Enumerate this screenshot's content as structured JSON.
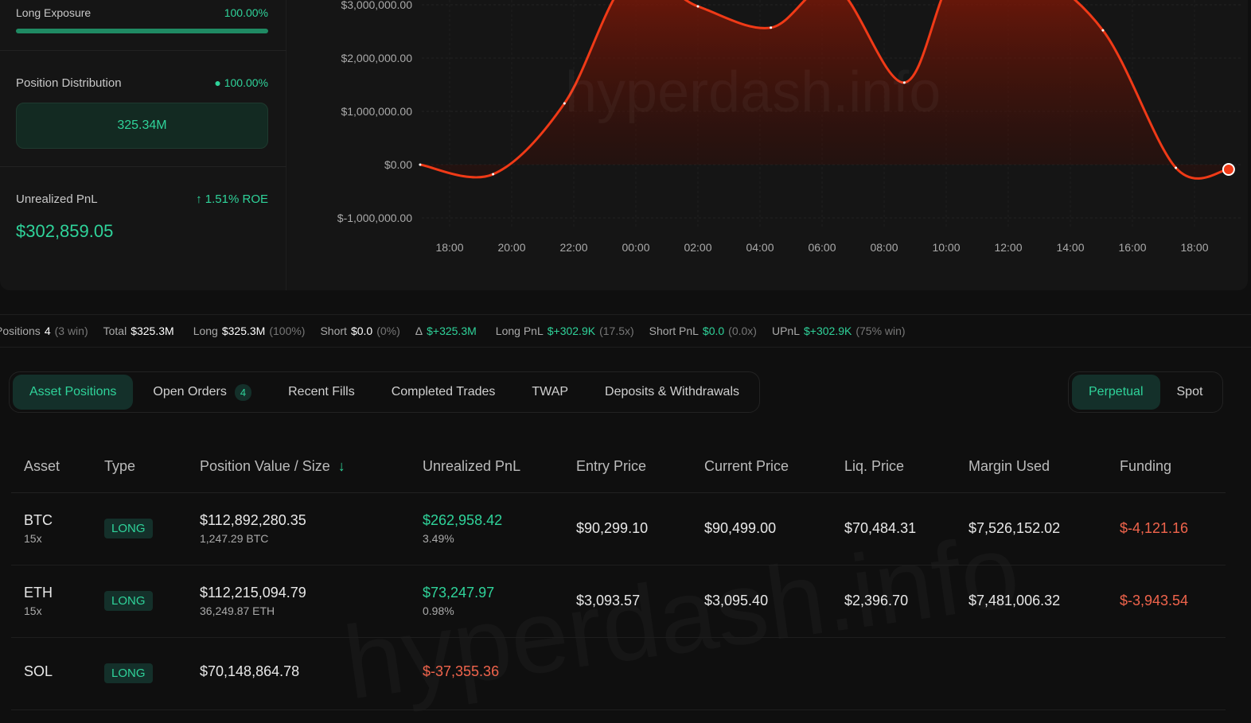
{
  "left": {
    "long_exposure_label": "Long Exposure",
    "long_exposure_value": "100.00%",
    "long_exposure_fraction": 1.0,
    "distribution_label": "Position Distribution",
    "distribution_value": "100.00%",
    "distribution_bar": "325.34M",
    "upnl_label": "Unrealized PnL",
    "upnl_roe": "↑ 1.51% ROE",
    "upnl_value": "$302,859.05"
  },
  "watermark": "hyperdash.info",
  "chart_data": {
    "type": "area",
    "color": "#f03a17",
    "yticks": [
      "$3,000,000.00",
      "$2,000,000.00",
      "$1,000,000.00",
      "$0.00",
      "$-1,000,000.00"
    ],
    "ytick_values": [
      3000000,
      2000000,
      1000000,
      0,
      -1000000
    ],
    "xticks": [
      "18:00",
      "20:00",
      "22:00",
      "00:00",
      "02:00",
      "04:00",
      "06:00",
      "08:00",
      "10:00",
      "12:00",
      "14:00",
      "16:00",
      "18:00"
    ],
    "x_hours_from_first_tick": [
      -0.95,
      1.4,
      3.7,
      5.8,
      8.0,
      10.35,
      12.4,
      14.65,
      16.3,
      18.5,
      21.05,
      23.4,
      25.1
    ],
    "values": [
      0,
      -180000,
      1150000,
      3500000,
      2970000,
      2570000,
      3350000,
      1540000,
      3600000,
      3700000,
      2520000,
      -60000,
      -90000
    ]
  },
  "stats": [
    {
      "label": "Positions",
      "value": "4",
      "extra": "(3 win)",
      "color": "w"
    },
    {
      "label": "Total",
      "value": "$325.3M",
      "extra": "",
      "color": "w"
    },
    {
      "label": "Long",
      "value": "$325.3M",
      "extra": "(100%)",
      "color": "w"
    },
    {
      "label": "Short",
      "value": "$0.0",
      "extra": "(0%)",
      "color": "w"
    },
    {
      "label": "Δ",
      "value": "$+325.3M",
      "extra": "",
      "color": "grn"
    },
    {
      "label": "Long PnL",
      "value": "$+302.9K",
      "extra": "(17.5x)",
      "color": "grn"
    },
    {
      "label": "Short PnL",
      "value": "$0.0",
      "extra": "(0.0x)",
      "color": "grn"
    },
    {
      "label": "UPnL",
      "value": "$+302.9K",
      "extra": "(75% win)",
      "color": "grn"
    }
  ],
  "tabs": [
    "Asset Positions",
    "Open Orders",
    "Recent Fills",
    "Completed Trades",
    "TWAP",
    "Deposits & Withdrawals"
  ],
  "open_orders_count": "4",
  "market_tabs": [
    "Perpetual",
    "Spot"
  ],
  "columns": [
    "Asset",
    "Type",
    "Position Value / Size",
    "Unrealized PnL",
    "Entry Price",
    "Current Price",
    "Liq. Price",
    "Margin Used",
    "Funding"
  ],
  "sort_icon": "arrow-down-icon",
  "rows": [
    {
      "asset": "BTC",
      "lev": "15x",
      "type": "LONG",
      "value": "$112,892,280.35",
      "size": "1,247.29 BTC",
      "pnl": "$262,958.42",
      "pnl_pct": "3.49%",
      "pnl_neg": false,
      "entry": "$90,299.10",
      "current": "$90,499.00",
      "liq": "$70,484.31",
      "margin": "$7,526,152.02",
      "funding": "$-4,121.16"
    },
    {
      "asset": "ETH",
      "lev": "15x",
      "type": "LONG",
      "value": "$112,215,094.79",
      "size": "36,249.87 ETH",
      "pnl": "$73,247.97",
      "pnl_pct": "0.98%",
      "pnl_neg": false,
      "entry": "$3,093.57",
      "current": "$3,095.40",
      "liq": "$2,396.70",
      "margin": "$7,481,006.32",
      "funding": "$-3,943.54"
    },
    {
      "asset": "SOL",
      "lev": "",
      "type": "LONG",
      "value": "$70,148,864.78",
      "size": "",
      "pnl": "$-37,355.36",
      "pnl_pct": "",
      "pnl_neg": true,
      "entry": "",
      "current": "",
      "liq": "",
      "margin": "",
      "funding": ""
    }
  ]
}
